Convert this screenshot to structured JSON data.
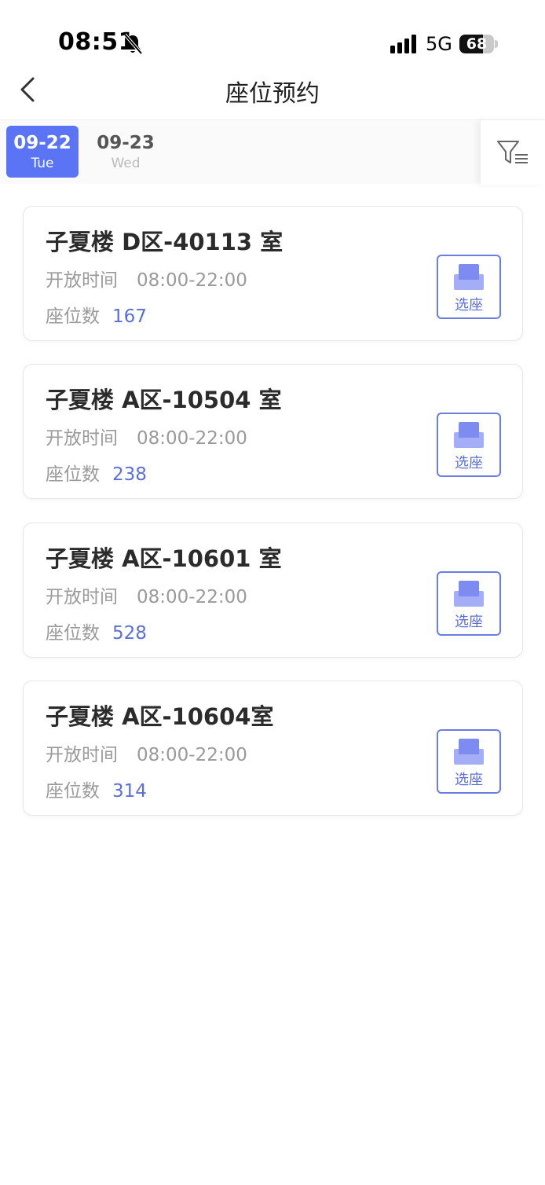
{
  "status_bar": {
    "time": "08:51",
    "network": "5G",
    "battery": "68",
    "battery_level": 0.68,
    "bell_icon": "bell-slash-icon",
    "signal_icon": "signal-bars-icon"
  },
  "nav": {
    "title": "座位预约",
    "back_icon": "chevron-left-icon"
  },
  "dates": [
    {
      "date": "09-22",
      "weekday": "Tue",
      "active": true
    },
    {
      "date": "09-23",
      "weekday": "Wed",
      "active": false
    }
  ],
  "filter_icon": "filter-list-icon",
  "rooms": [
    {
      "name": "子夏楼 D区-40113 室",
      "open_label": "开放时间",
      "open_time": "08:00-22:00",
      "seats_label": "座位数",
      "seats": "167",
      "button_label": "选座"
    },
    {
      "name": "子夏楼 A区-10504 室",
      "open_label": "开放时间",
      "open_time": "08:00-22:00",
      "seats_label": "座位数",
      "seats": "238",
      "button_label": "选座"
    },
    {
      "name": "子夏楼 A区-10601 室",
      "open_label": "开放时间",
      "open_time": "08:00-22:00",
      "seats_label": "座位数",
      "seats": "528",
      "button_label": "选座"
    },
    {
      "name": "子夏楼 A区-10604室",
      "open_label": "开放时间",
      "open_time": "08:00-22:00",
      "seats_label": "座位数",
      "seats": "314",
      "button_label": "选座"
    }
  ],
  "colors": {
    "accent": "#5b74f5",
    "seat_icon": "#8a98f5",
    "seat_count": "#5b6fd8"
  }
}
